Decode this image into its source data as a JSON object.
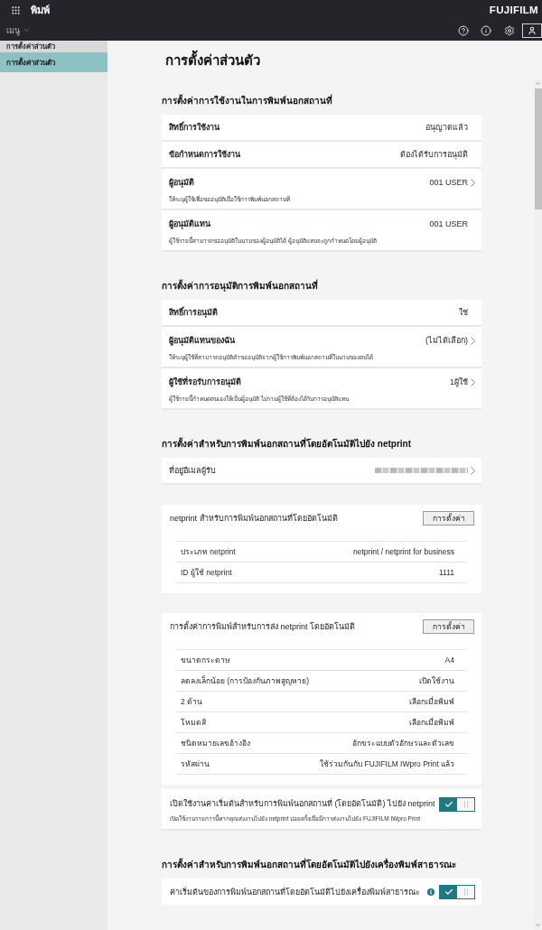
{
  "header": {
    "app_title": "พิมพ์",
    "brand": "FUJIFILM",
    "menu": "เมนู"
  },
  "sidebar": {
    "heading": "การตั้งค่าส่วนตัว",
    "items": [
      {
        "label": "การตั้งค่าส่วนตัว",
        "selected": true
      }
    ]
  },
  "page_title": "การตั้งค่าส่วนตัว",
  "sections": [
    {
      "heading": "การตั้งค่าการใช้งานในการพิมพ์นอกสถานที่",
      "blocks": [
        {
          "kind": "rows",
          "rows": [
            {
              "label": "สิทธิ์การใช้งาน",
              "value": "อนุญาตแล้ว",
              "navigable": false
            },
            {
              "label": "ข้อกำหนดการใช้งาน",
              "value": "ต้องได้รับการอนุมัติ",
              "navigable": false
            },
            {
              "label": "ผู้อนุมัติ",
              "value": "001 USER",
              "description": "ให้ระบุผู้ใช้เพื่อขออนุมัติเมื่อใช้การพิมพ์นอกสถานที่",
              "navigable": true
            },
            {
              "label": "ผู้อนุมัติแทน",
              "value": "001 USER",
              "description": "ผู้ใช้รายนี้สามารถขออนุมัติในนามของผู้อนุมัติได้ ผู้อนุมัติแทนจะถูกกำหนดโดยผู้อนุมัติ",
              "navigable": false
            }
          ]
        }
      ]
    },
    {
      "heading": "การตั้งค่าการอนุมัติการพิมพ์นอกสถานที่",
      "blocks": [
        {
          "kind": "rows",
          "rows": [
            {
              "label": "สิทธิ์การอนุมัติ",
              "value": "ใช่",
              "navigable": false
            },
            {
              "label": "ผู้อนุมัติแทนของฉัน",
              "value": "(ไม่ได้เลือก)",
              "description": "ให้ระบุผู้ใช้ที่สามารถอนุมัติคำขออนุมัติจากผู้ใช้การพิมพ์นอกสถานที่ในนามของตนได้",
              "navigable": true
            },
            {
              "label": "ผู้ใช้ที่รอรับการอนุมัติ",
              "value": "1ผู้ใช้",
              "description": "ผู้ใช้รายนี้กำหนดตนเองให้เป็นผู้อนุมัติ ไม่รวมผู้ใช้ที่ต้องได้รับการอนุมัติแทน",
              "navigable": true
            }
          ]
        }
      ]
    },
    {
      "heading": "การตั้งค่าสำหรับการพิมพ์นอกสถานที่โดยอัตโนมัติไปยัง netprint",
      "blocks": [
        {
          "kind": "link",
          "label": "ที่อยู่อีเมลผู้รับ",
          "value_blurred": true,
          "navigable": true
        },
        {
          "kind": "detail",
          "title": "netprint สำหรับการพิมพ์นอกสถานที่โดยอัตโนมัติ",
          "button": "การตั้งค่า",
          "items": [
            {
              "label": "ประเภท netprint",
              "value": "netprint / netprint for business"
            },
            {
              "label": "ID ผู้ใช้ netprint",
              "value": "1111"
            }
          ]
        },
        {
          "kind": "detail",
          "title": "การตั้งค่าการพิมพ์สำหรับการส่ง netprint โดยอัตโนมัติ",
          "button": "การตั้งค่า",
          "items": [
            {
              "label": "ขนาดกระดาษ",
              "value": "A4"
            },
            {
              "label": "ลดลงเล็กน้อย (การป้องกันภาพสูญหาย)",
              "value": "เปิดใช้งาน"
            },
            {
              "label": "2 ด้าน",
              "value": "เลือกเมื่อพิมพ์"
            },
            {
              "label": "โหมดสี",
              "value": "เลือกเมื่อพิมพ์"
            },
            {
              "label": "ชนิดหมายเลขอ้างอิง",
              "value": "อักขระแบบตัวอักษรและตัวเลข"
            },
            {
              "label": "รหัสผ่าน",
              "value": "ใช้ร่วมกันกับ FUJIFILM IWpro Print แล้ว"
            }
          ]
        },
        {
          "kind": "toggle",
          "label": "เปิดใช้งานค่าเริ่มต้นสำหรับการพิมพ์นอกสถานที่ (โดยอัตโนมัติ) ไปยัง netprint",
          "description": "เปิดใช้งานรายการนี้หากคุณส่งงานไปยัง netprint บ่อยครั้งเมื่อมีการส่งงานไปยัง FUJIFILM IWpro Print",
          "on": true
        }
      ]
    },
    {
      "heading": "การตั้งค่าสำหรับการพิมพ์นอกสถานที่โดยอัตโนมัติไปยังเครื่องพิมพ์สาธารณะ",
      "blocks": [
        {
          "kind": "toggle",
          "label": "ค่าเริ่มต้นของการพิมพ์นอกสถานที่โดยอัตโนมัติไปยังเครื่องพิมพ์สาธารณะ",
          "info": true,
          "on": true
        }
      ]
    }
  ]
}
